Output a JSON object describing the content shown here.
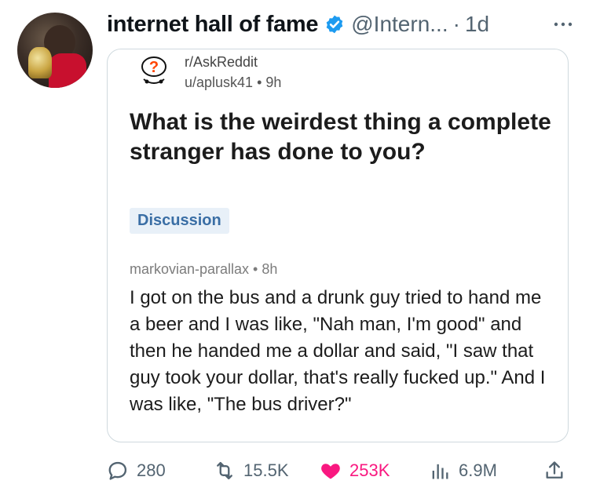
{
  "tweet": {
    "display_name": "internet hall of fame",
    "handle": "@Intern...",
    "separator": "·",
    "time": "1d"
  },
  "quote": {
    "subreddit": "r/AskReddit",
    "byline": "u/aplusk41 • 9h",
    "title": "What is the weirdest thing a complete stranger has done to you?",
    "flair": "Discussion",
    "comment_meta": "markovian-parallax • 8h",
    "comment_body": "I got on the bus and a drunk guy tried to hand me a beer and I was like, \"Nah man, I'm good\" and then he handed me a dollar and said, \"I saw that guy took your dollar, that's really fucked up.\" And I was like, \"The bus driver?\""
  },
  "actions": {
    "replies": "280",
    "reposts": "15.5K",
    "likes": "253K",
    "views": "6.9M"
  },
  "colors": {
    "verified": "#1d9bf0",
    "like": "#f91880",
    "muted": "#536471"
  },
  "icons": [
    "verified-badge-icon",
    "more-icon",
    "snoo-question-icon",
    "reply-icon",
    "repost-icon",
    "heart-icon",
    "views-icon",
    "share-icon"
  ]
}
